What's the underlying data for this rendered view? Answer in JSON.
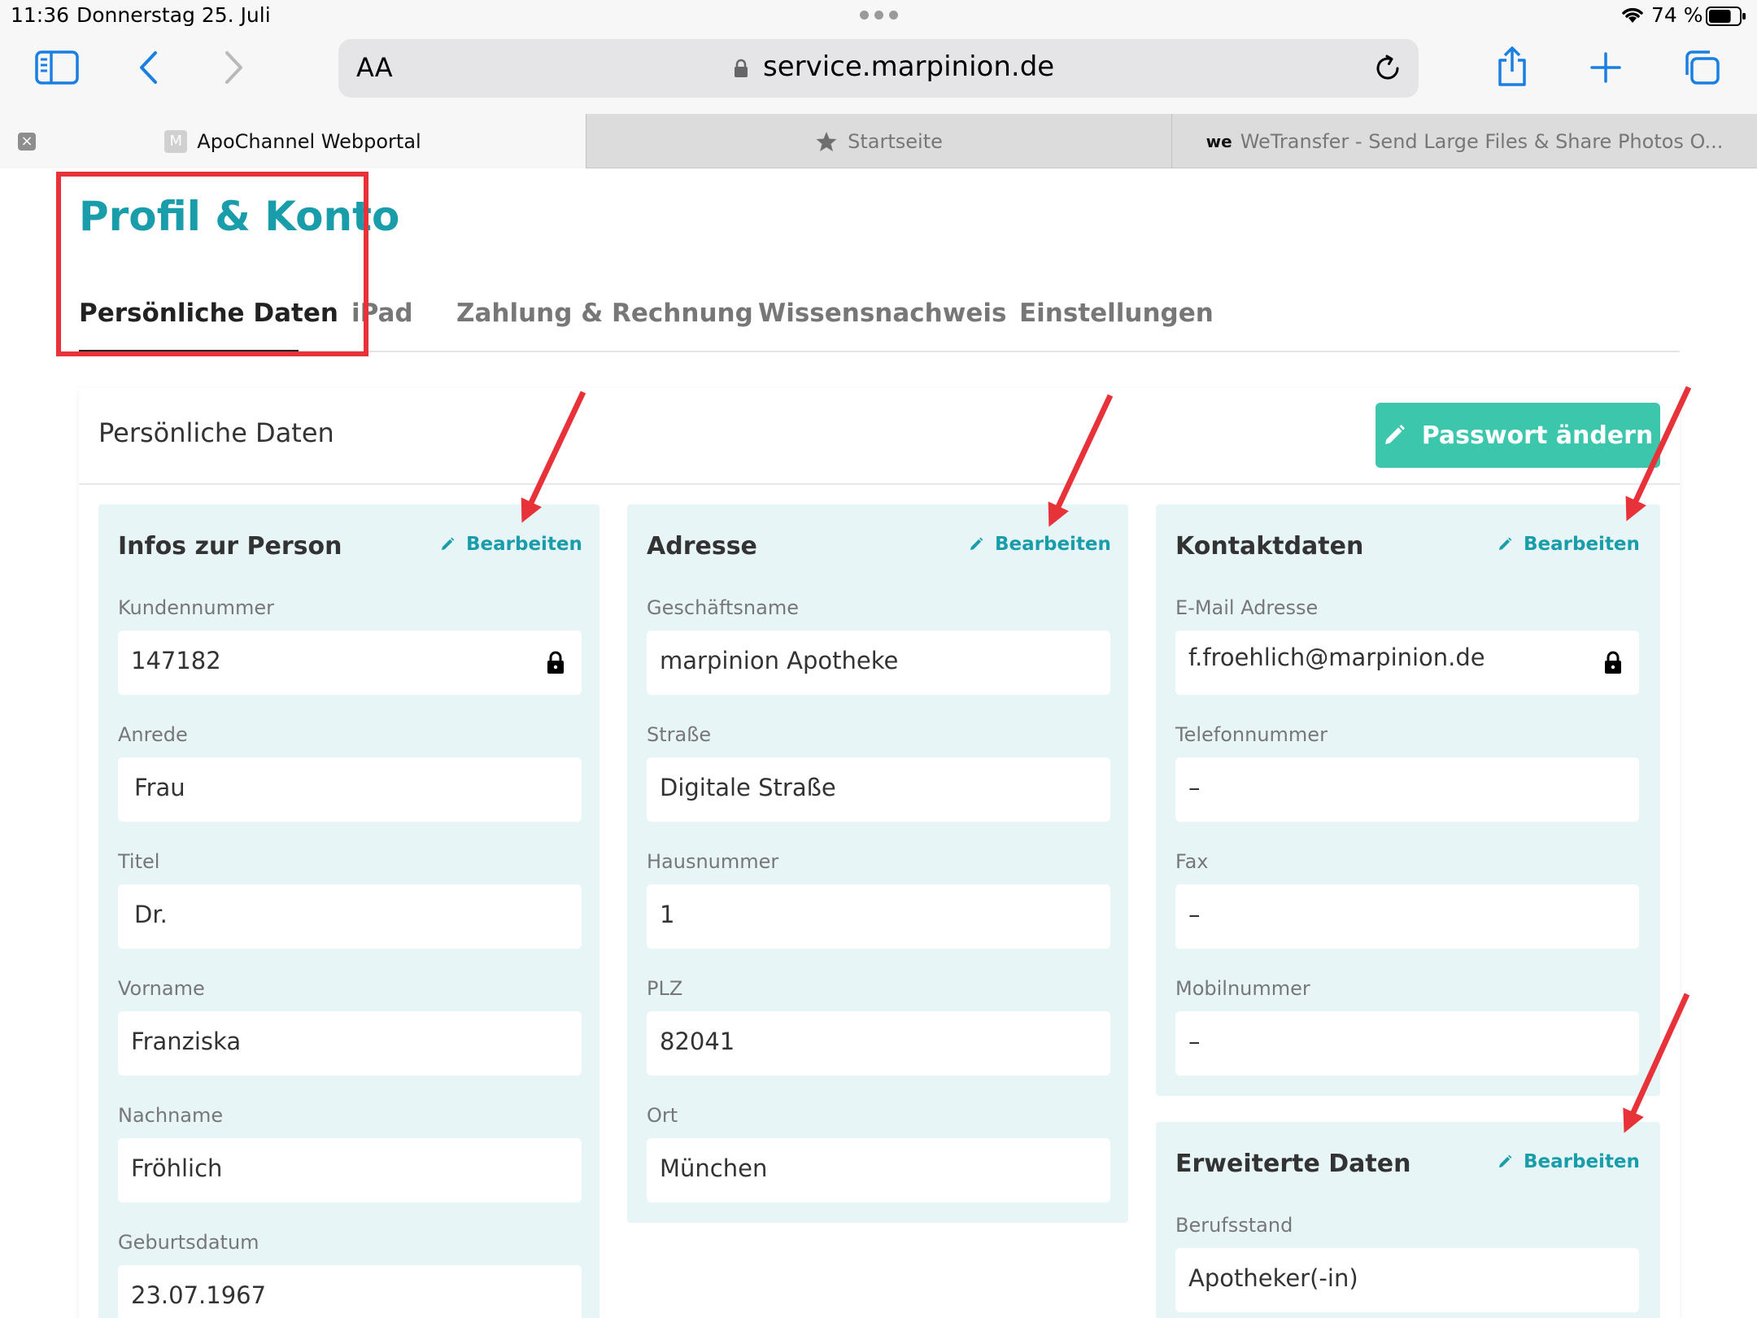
{
  "status_bar": {
    "time": "11:36",
    "date": "Donnerstag 25. Juli",
    "battery_percent": "74 %",
    "battery_level": 0.74
  },
  "toolbar": {
    "text_size_label": "AA",
    "url": "service.marpinion.de"
  },
  "browser_tabs": [
    {
      "title": "ApoChannel Webportal",
      "favicon": "M",
      "active": true
    },
    {
      "title": "Startseite",
      "favicon": "star-icon",
      "active": false
    },
    {
      "title": "WeTransfer - Send Large Files & Share Photos O...",
      "favicon": "we",
      "active": false
    }
  ],
  "page": {
    "title": "Profil & Konto",
    "subnav": [
      {
        "label": "Persönliche Daten",
        "active": true
      },
      {
        "label": "iPad",
        "active": false
      },
      {
        "label": "Zahlung & Rechnung",
        "active": false
      },
      {
        "label": "Wissensnachweis",
        "active": false
      },
      {
        "label": "Einstellungen",
        "active": false
      }
    ]
  },
  "card": {
    "title": "Persönliche Daten",
    "password_button": "Passwort ändern",
    "edit_label": "Bearbeiten",
    "sections": {
      "person": {
        "heading": "Infos zur Person",
        "fields": [
          {
            "label": "Kundennummer",
            "value": "147182",
            "locked": true
          },
          {
            "label": "Anrede",
            "value": "Frau"
          },
          {
            "label": "Titel",
            "value": "Dr."
          },
          {
            "label": "Vorname",
            "value": "Franziska"
          },
          {
            "label": "Nachname",
            "value": "Fröhlich"
          },
          {
            "label": "Geburtsdatum",
            "value": "23.07.1967"
          }
        ]
      },
      "address": {
        "heading": "Adresse",
        "fields": [
          {
            "label": "Geschäftsname",
            "value": "marpinion Apotheke"
          },
          {
            "label": "Straße",
            "value": "Digitale Straße"
          },
          {
            "label": "Hausnummer",
            "value": "1"
          },
          {
            "label": "PLZ",
            "value": "82041"
          },
          {
            "label": "Ort",
            "value": "München"
          }
        ]
      },
      "contact": {
        "heading": "Kontaktdaten",
        "fields": [
          {
            "label": "E-Mail Adresse",
            "value": "f.froehlich@marpinion.de",
            "locked": true
          },
          {
            "label": "Telefonnummer",
            "value": "–"
          },
          {
            "label": "Fax",
            "value": "–"
          },
          {
            "label": "Mobilnummer",
            "value": "–"
          }
        ]
      },
      "extended": {
        "heading": "Erweiterte Daten",
        "fields": [
          {
            "label": "Berufsstand",
            "value": "Apotheker(-in)"
          }
        ]
      }
    }
  },
  "colors": {
    "accent": "#1a9dab",
    "button": "#3cc7ad",
    "section_bg": "#e8f5f7",
    "annotation": "#e8323a"
  }
}
